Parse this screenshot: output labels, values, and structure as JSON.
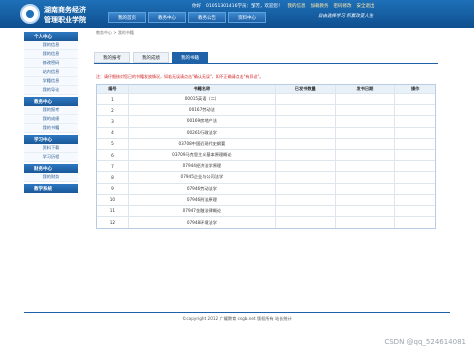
{
  "header": {
    "logo_line1": "湖南商务经济",
    "logo_line2": "管理职业学院",
    "user_label": "你好",
    "phone": "01051301416学员：邹芳，欢迎您！",
    "links": [
      "我的信息",
      "加载教务",
      "密码修改",
      "安全退出"
    ],
    "tabs": [
      "我的首页",
      "教务中心",
      "教务公告",
      "资料中心"
    ],
    "slogan": "自由选择学习  积累改变人生"
  },
  "sidebar": {
    "sections": [
      {
        "title": "个人中心",
        "items": [
          "我的信息",
          "我的信息",
          "修改密码",
          "站内信息",
          "学籍信息",
          "我的导论"
        ]
      },
      {
        "title": "教务中心",
        "items": [
          "我的报考",
          "我的成绩",
          "我的书籍"
        ]
      },
      {
        "title": "学习中心",
        "items": [
          "资料下载",
          "学习历程"
        ]
      },
      {
        "title": "财务中心",
        "items": [
          "我的财务"
        ]
      },
      {
        "title": "教学系统",
        "items": []
      }
    ]
  },
  "content": {
    "breadcrumb": "教务中心  >  我的书籍",
    "tabs": [
      "我的报考",
      "我的成绩",
      "我的书籍"
    ],
    "active_tab": "我的书籍",
    "notice": "注：请仔细核对您已的书籍发放情况，如若无误请点击\"确认无误\"，如不正确请点击\"有异议\"。",
    "table": {
      "headers": [
        "编号",
        "书籍名称",
        "已发书数量",
        "发书日期",
        "操作"
      ],
      "rows": [
        [
          "1",
          "00015英语（二）",
          "",
          "",
          ""
        ],
        [
          "2",
          "00167劳动法",
          "",
          "",
          ""
        ],
        [
          "3",
          "00169房地产法",
          "",
          "",
          ""
        ],
        [
          "4",
          "00261行政法学",
          "",
          "",
          ""
        ],
        [
          "5",
          "03708中国近现代史纲要",
          "",
          "",
          ""
        ],
        [
          "6",
          "03709马克思主义基本原理概论",
          "",
          "",
          ""
        ],
        [
          "7",
          "07944经济法学原理",
          "",
          "",
          ""
        ],
        [
          "8",
          "07945企业与公司法学",
          "",
          "",
          ""
        ],
        [
          "9",
          "07946劳动法学",
          "",
          "",
          ""
        ],
        [
          "10",
          "07946刑法原理",
          "",
          "",
          ""
        ],
        [
          "11",
          "07947金融法律概论",
          "",
          "",
          ""
        ],
        [
          "12",
          "07948环境法学",
          "",
          "",
          ""
        ]
      ]
    }
  },
  "footer": {
    "copyright": "©copyright 2012 广耀教育 csgb.net 版权所有 站长统计",
    "watermark": "CSDN @qq_524614081"
  },
  "colors": {
    "primary": "#1f62a8",
    "notice": "#d02020"
  }
}
